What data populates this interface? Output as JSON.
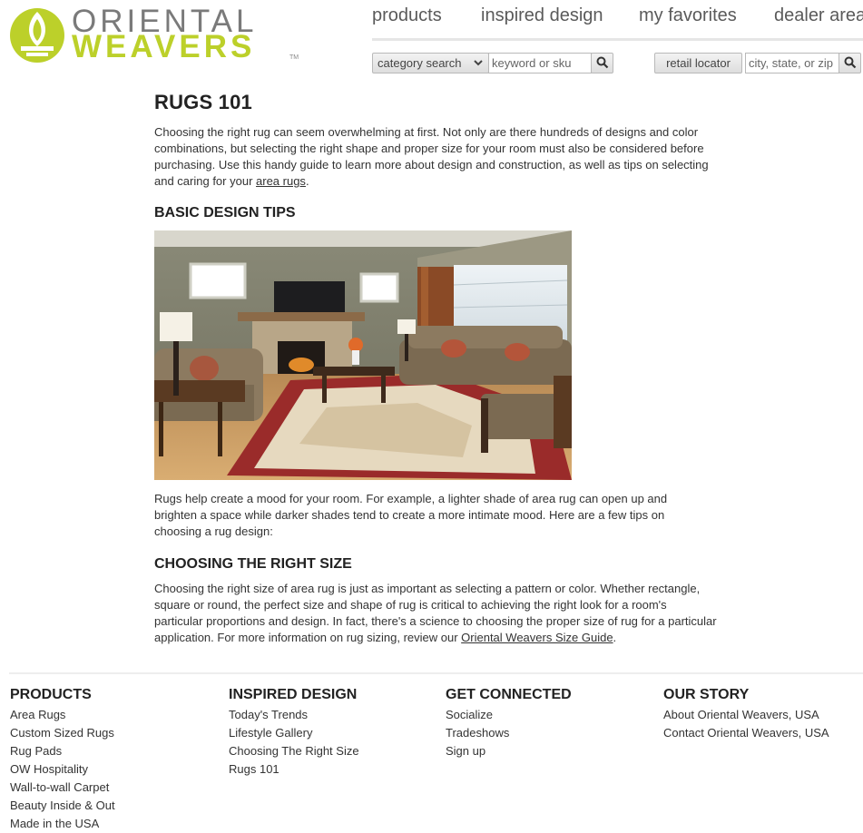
{
  "brand": {
    "line1": "ORIENTAL",
    "line2": "WEAVERS",
    "tm": "TM",
    "colors": {
      "green": "#bcd02a",
      "gray": "#7a7a7a"
    }
  },
  "topnav": [
    "products",
    "inspired design",
    "my favorites",
    "dealer area"
  ],
  "search": {
    "category_label": "category search",
    "keyword_placeholder": "keyword or sku",
    "retail_label": "retail locator",
    "location_placeholder": "city, state, or zip"
  },
  "main": {
    "title": "RUGS 101",
    "intro_text": "Choosing the right rug can seem overwhelming at first. Not only are there hundreds of designs and color combinations, but selecting the right shape and proper size for your room must also be considered before purchasing. Use this handy guide to learn more about design and construction, as well as tips on selecting and caring for your ",
    "intro_link": "area rugs",
    "intro_end": ".",
    "tips_heading": "BASIC DESIGN TIPS",
    "tips_text": "Rugs help create a mood for your room. For example, a lighter shade of area rug can open up and brighten a space while darker shades tend to create a more intimate mood. Here are a few tips on choosing a rug design:",
    "size_heading": "CHOOSING THE RIGHT SIZE",
    "size_text": "Choosing the right size of area rug is just as important as selecting a pattern or color. Whether rectangle, square or round, the perfect size and shape of rug is critical to achieving the right look for a room's particular proportions and design. In fact, there's a science to choosing the proper size of rug for a particular application. For more information on rug sizing, review our ",
    "size_link": "Oriental Weavers Size Guide",
    "size_end": "."
  },
  "footer": {
    "products": {
      "heading": "PRODUCTS",
      "links": [
        "Area Rugs",
        "Custom Sized Rugs",
        "Rug Pads",
        "OW Hospitality",
        "Wall-to-wall Carpet",
        "Beauty Inside & Out",
        "Made in the USA"
      ]
    },
    "inspired": {
      "heading": "INSPIRED DESIGN",
      "links": [
        "Today's Trends",
        "Lifestyle Gallery",
        "Choosing The Right Size",
        "Rugs 101"
      ]
    },
    "connected": {
      "heading": "GET CONNECTED",
      "links": [
        "Socialize",
        "Tradeshows",
        "Sign up"
      ]
    },
    "story": {
      "heading": "OUR STORY",
      "links": [
        "About Oriental Weavers, USA",
        "Contact Oriental Weavers, USA"
      ]
    }
  }
}
